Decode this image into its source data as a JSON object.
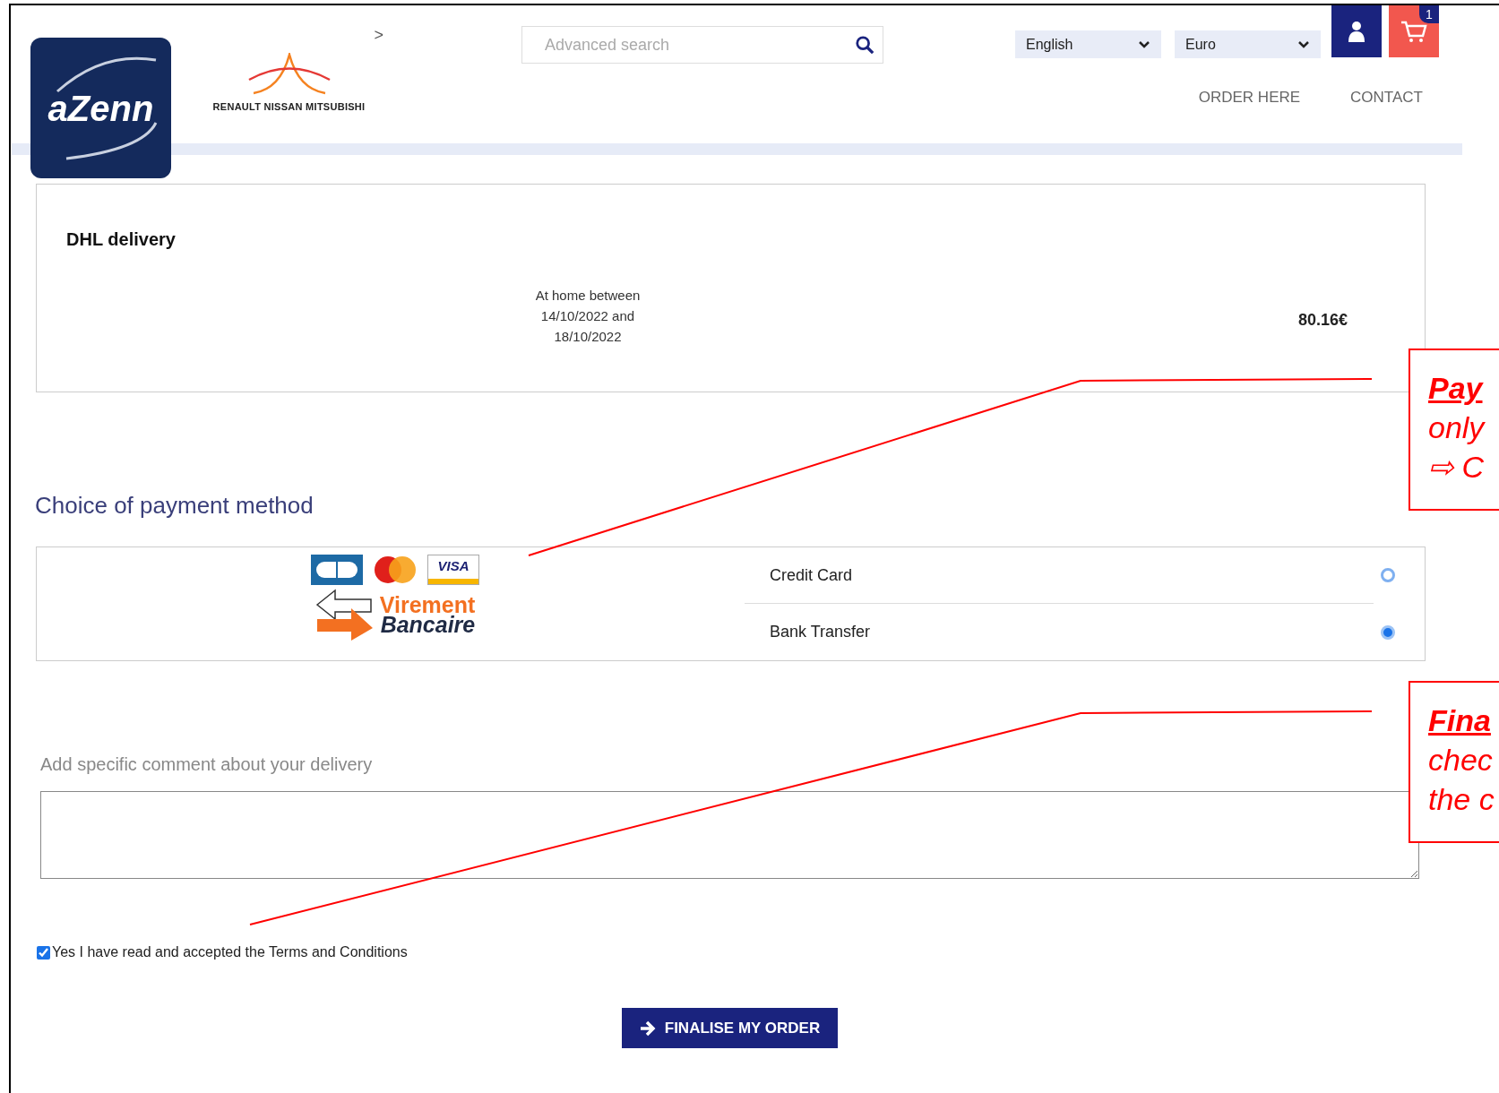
{
  "header": {
    "chevron": ">",
    "logo_text": "aZenn",
    "partner_text": "RENAULT NISSAN MITSUBISHI",
    "search": {
      "placeholder": "Advanced search"
    },
    "selects": [
      {
        "value": "English"
      },
      {
        "value": "Euro"
      }
    ],
    "cart_count": "1",
    "nav": [
      "ORDER HERE",
      "CONTACT"
    ]
  },
  "delivery": {
    "title": "DHL delivery",
    "window_lines": [
      "At home between",
      "14/10/2022 and",
      "18/10/2022"
    ],
    "price": "80.16€"
  },
  "payment": {
    "heading": "Choice of payment method",
    "visa_text": "VISA",
    "bank_logo_lines": [
      "Virement",
      "Bancaire"
    ],
    "options": [
      {
        "label": "Credit Card",
        "selected": false
      },
      {
        "label": "Bank Transfer",
        "selected": true
      }
    ]
  },
  "comment": {
    "label": "Add specific comment about your delivery"
  },
  "terms": {
    "label": "Yes I have read and accepted the Terms and Conditions",
    "checked": true
  },
  "submit": {
    "label": "FINALISE MY ORDER"
  },
  "annotations": [
    {
      "title": "Pay",
      "lines": [
        "only",
        "⇨ C"
      ]
    },
    {
      "title": "Fina",
      "lines": [
        "chec",
        "the c"
      ]
    }
  ]
}
